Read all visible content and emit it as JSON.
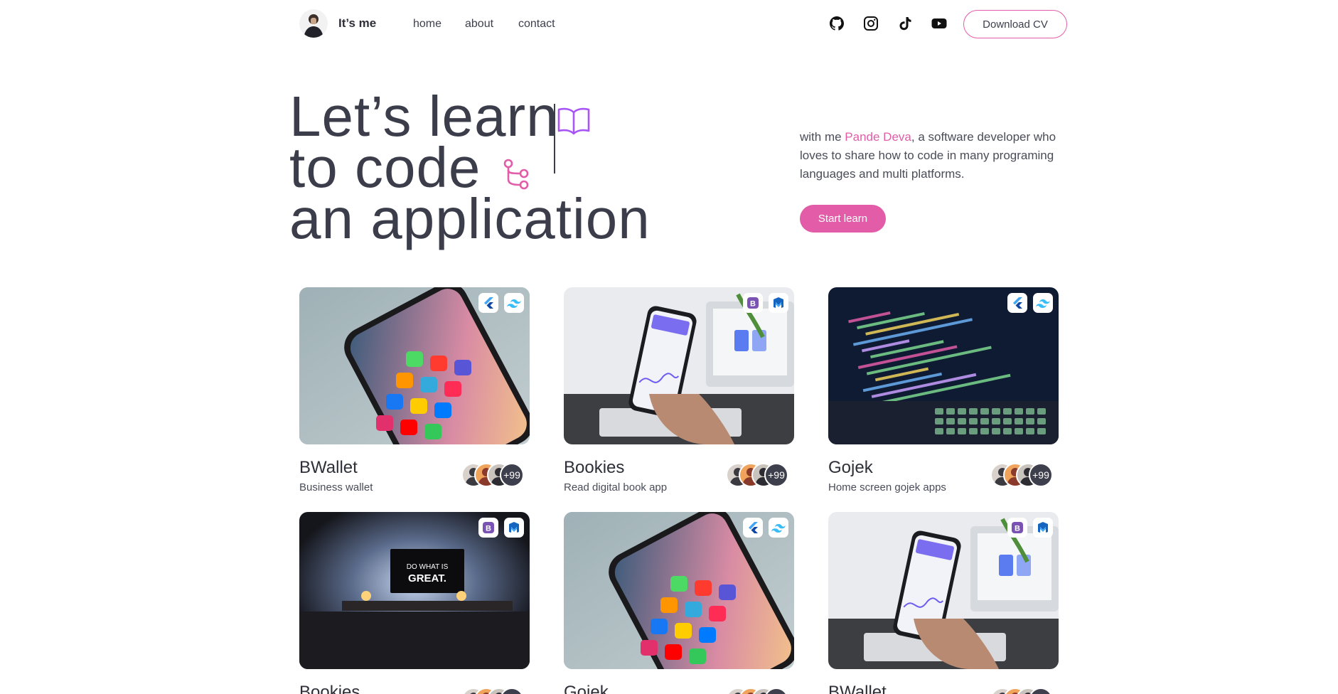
{
  "nav": {
    "brand": "It’s me",
    "links": [
      "home",
      "about",
      "contact"
    ],
    "socials": [
      "github-icon",
      "instagram-icon",
      "tiktok-icon",
      "youtube-icon"
    ],
    "cv_button": "Download CV"
  },
  "hero": {
    "line1": "Let’s learn",
    "line2": "to code",
    "line3": "an application",
    "desc_prefix": "with me ",
    "desc_name": "Pande Deva",
    "desc_suffix": ", a software developer who loves to share how to code in many programing languages and multi platforms.",
    "cta": "Start learn"
  },
  "colors": {
    "accent": "#e25ca8",
    "text": "#3b3d4a",
    "dark_badge": "#3d3f4d"
  },
  "projects": [
    {
      "title": "BWallet",
      "subtitle": "Business wallet",
      "image": "phone-homescreen",
      "tech": [
        "flutter-icon",
        "tailwind-icon"
      ],
      "members_more": "+99"
    },
    {
      "title": "Bookies",
      "subtitle": "Read digital book app",
      "image": "hand-phone-desk",
      "tech": [
        "bootstrap-icon",
        "material-icon"
      ],
      "members_more": "+99"
    },
    {
      "title": "Gojek",
      "subtitle": "Home screen gojek apps",
      "image": "code-laptop",
      "tech": [
        "flutter-icon",
        "tailwind-icon"
      ],
      "members_more": "+99"
    },
    {
      "title": "Bookies",
      "subtitle": "",
      "image": "do-what-is-great",
      "tech": [
        "bootstrap-icon",
        "material-icon"
      ],
      "members_more": ""
    },
    {
      "title": "Gojek",
      "subtitle": "",
      "image": "phone-homescreen",
      "tech": [
        "flutter-icon",
        "tailwind-icon"
      ],
      "members_more": ""
    },
    {
      "title": "BWallet",
      "subtitle": "",
      "image": "hand-phone-desk",
      "tech": [
        "bootstrap-icon",
        "material-icon"
      ],
      "members_more": ""
    }
  ],
  "image_text": {
    "monitor_line1": "DO WHAT IS",
    "monitor_line2": "GREAT."
  }
}
